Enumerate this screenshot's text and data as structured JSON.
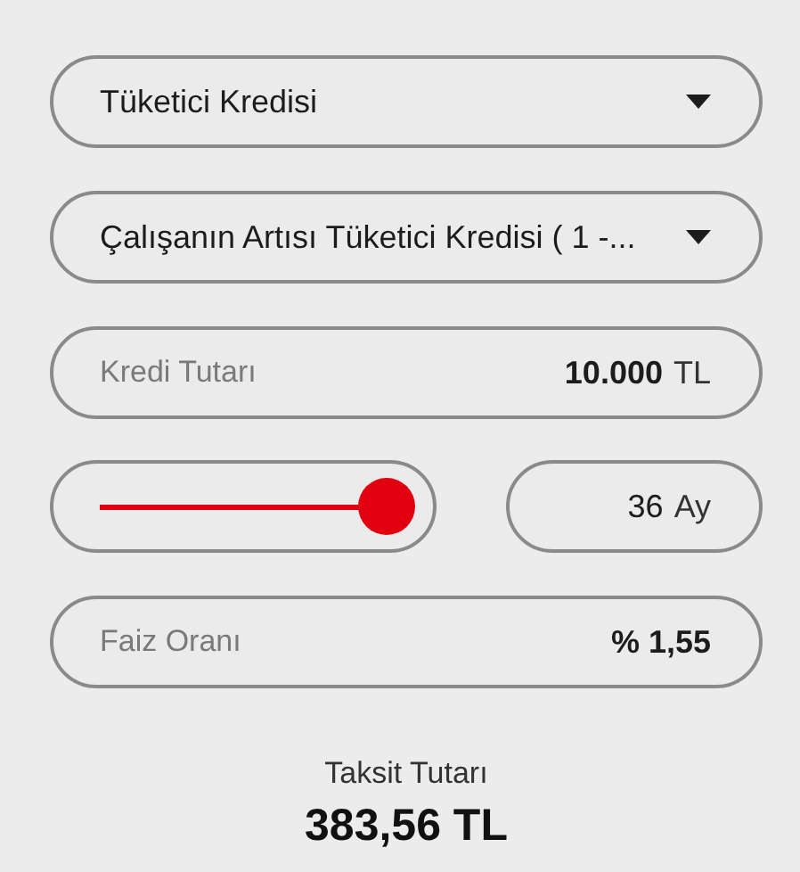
{
  "loan_type": {
    "value": "Tüketici Kredisi"
  },
  "loan_product": {
    "value": "Çalışanın Artısı Tüketici Kredisi ( 1 -..."
  },
  "loan_amount": {
    "label": "Kredi Tutarı",
    "value": "10.000",
    "unit": "TL"
  },
  "term": {
    "level": 1.0,
    "value": "36",
    "unit": "Ay"
  },
  "interest_rate": {
    "label": "Faiz Oranı",
    "value": "% 1,55"
  },
  "installment": {
    "label": "Taksit Tutarı",
    "value": "383,56 TL"
  }
}
